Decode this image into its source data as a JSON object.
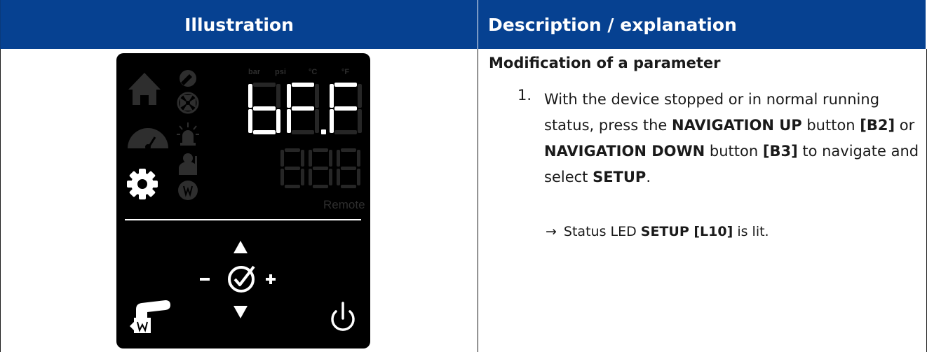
{
  "header": {
    "illustration": "Illustration",
    "description": "Description / explanation"
  },
  "panel": {
    "unit_labels": [
      "bar",
      "psi",
      "°C",
      "°F"
    ],
    "display_main": "bF.F",
    "display_secondary": "888",
    "remote_label": "Remote",
    "colors": {
      "background": "#000000",
      "lit": "#ffffff",
      "unlit": "#2a2a2a"
    },
    "icons": [
      "home-icon",
      "compressor-icon",
      "fan-icon",
      "gauge-icon",
      "alarm-icon",
      "service-icon",
      "settings-icon",
      "drain-icon",
      "nav-up-icon",
      "minus-icon",
      "confirm-icon",
      "plus-icon",
      "nav-down-icon",
      "manual-drain-icon",
      "power-icon"
    ]
  },
  "description": {
    "title": "Modification of a parameter",
    "step_number": "1.",
    "step_parts": [
      "With the device stopped or in normal running status, press the ",
      "NAVIGATION UP",
      " button ",
      "[B2]",
      " or ",
      "NAVIGATION DOWN",
      " button ",
      "[B3]",
      " to navigate and select ",
      "SETUP",
      "."
    ],
    "result_arrow": "→",
    "result_parts": [
      "Status LED ",
      "SETUP [L10]",
      " is lit."
    ]
  },
  "colors": {
    "header_bg": "#064191",
    "header_text": "#ffffff",
    "body_text": "#1a1a1a"
  }
}
